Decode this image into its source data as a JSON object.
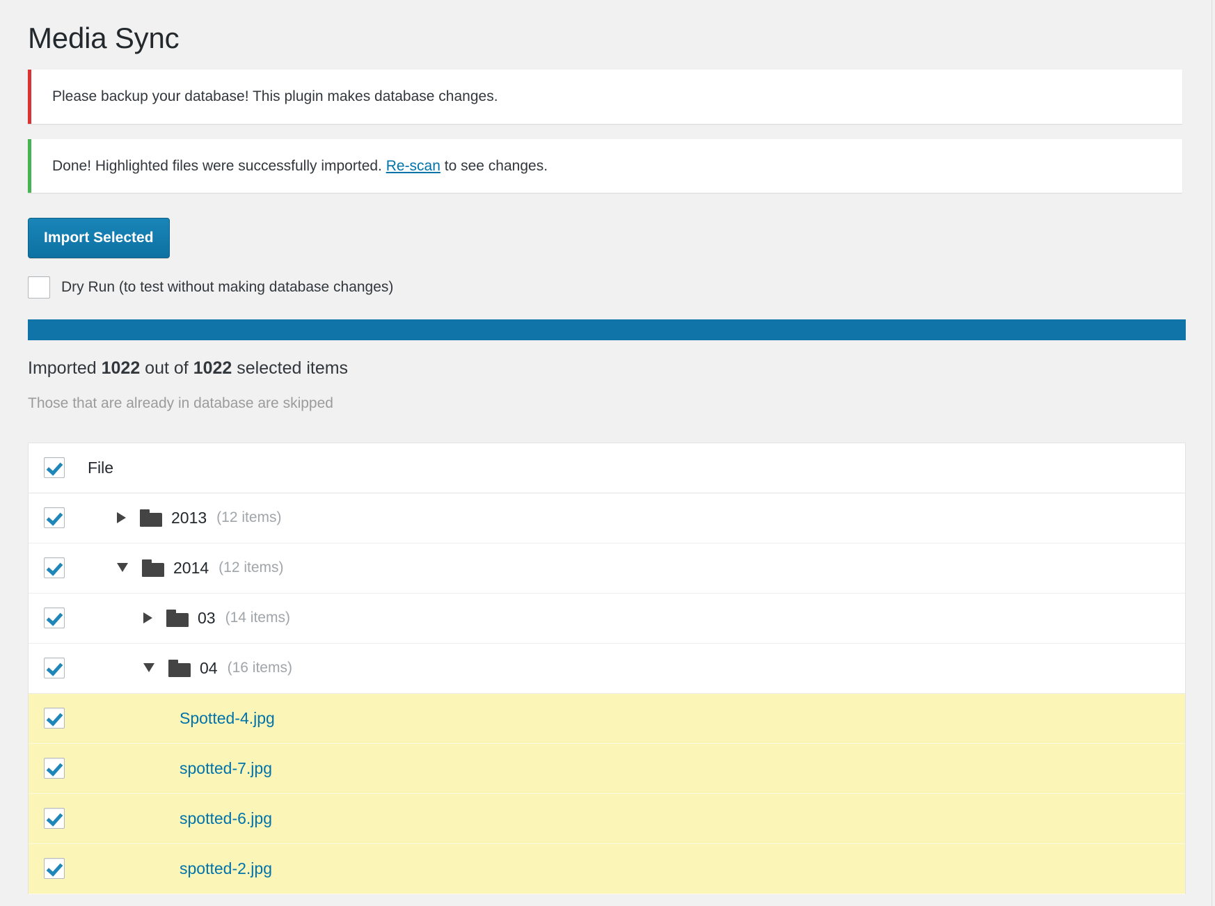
{
  "page": {
    "title": "Media Sync"
  },
  "notices": [
    {
      "type": "error",
      "text": "Please backup your database! This plugin makes database changes."
    },
    {
      "type": "success",
      "text_before": "Done! Highlighted files were successfully imported. ",
      "link_label": "Re-scan",
      "text_after": " to see changes."
    }
  ],
  "actions": {
    "import_button_label": "Import Selected",
    "dry_run_label": "Dry Run (to test without making database changes)",
    "dry_run_checked": false
  },
  "progress": {
    "percent": 100,
    "percent_css": "100%"
  },
  "status": {
    "prefix": "Imported ",
    "imported_count": "1022",
    "middle": " out of ",
    "total_count": "1022",
    "suffix": " selected items",
    "sub_note": "Those that are already in database are skipped"
  },
  "table": {
    "header_label": "File",
    "header_checked": true,
    "rows": [
      {
        "kind": "folder",
        "indent": 1,
        "expanded": false,
        "checked": true,
        "name": "2013",
        "count": "(12 items)",
        "highlight": false
      },
      {
        "kind": "folder",
        "indent": 1,
        "expanded": true,
        "checked": true,
        "name": "2014",
        "count": "(12 items)",
        "highlight": false
      },
      {
        "kind": "folder",
        "indent": 2,
        "expanded": false,
        "checked": true,
        "name": "03",
        "count": "(14 items)",
        "highlight": false
      },
      {
        "kind": "folder",
        "indent": 2,
        "expanded": true,
        "checked": true,
        "name": "04",
        "count": "(16 items)",
        "highlight": false
      },
      {
        "kind": "file",
        "indent": 3,
        "checked": true,
        "name": "Spotted-4.jpg",
        "highlight": true
      },
      {
        "kind": "file",
        "indent": 3,
        "checked": true,
        "name": "spotted-7.jpg",
        "highlight": true
      },
      {
        "kind": "file",
        "indent": 3,
        "checked": true,
        "name": "spotted-6.jpg",
        "highlight": true
      },
      {
        "kind": "file",
        "indent": 3,
        "checked": true,
        "name": "spotted-2.jpg",
        "highlight": true
      }
    ]
  },
  "colors": {
    "accent": "#0073aa",
    "progress_fill": "#1174a8",
    "button": "#0e76a8",
    "error": "#dc3232",
    "success": "#46b450",
    "highlight_row": "#fcf5b8",
    "muted_text": "#a0a5aa",
    "page_bg": "#f1f1f1"
  }
}
